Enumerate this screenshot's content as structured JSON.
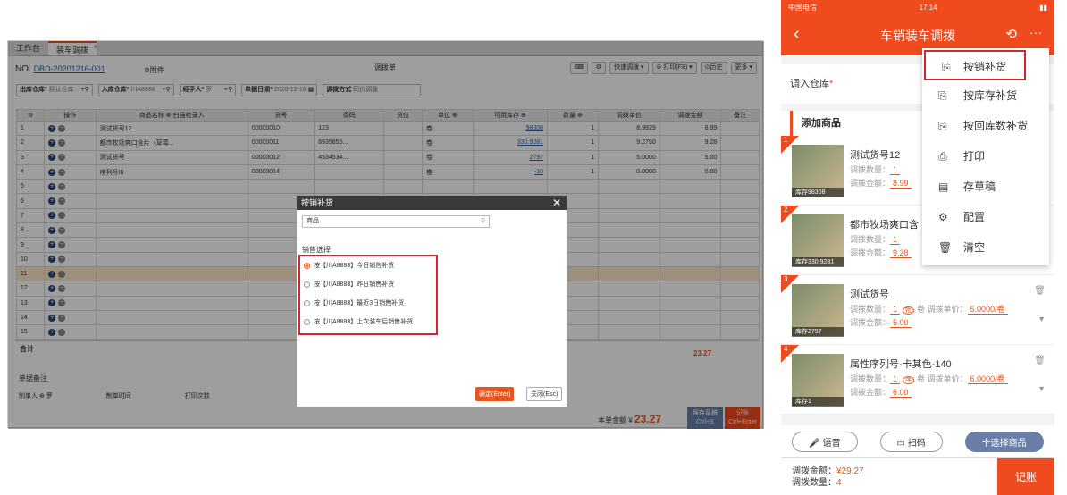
{
  "desktop": {
    "tabs": [
      "工作台",
      "装车调拨"
    ],
    "no_label": "NO.",
    "no_value": "DBD-20201216-001",
    "attach": "⊘附件",
    "title": "调拨单",
    "buttons": [
      "快速调拨 ▾",
      "⊜ 打印(F8) ▾",
      "⊙历史",
      "更多 ▾"
    ],
    "fields": {
      "out_wh": "出库仓库*",
      "out_wh_v": "默认仓库",
      "in_wh": "入库仓库*",
      "in_wh_v": "川A8888",
      "handler": "经手人*",
      "handler_v": "罗",
      "date": "单据日期*",
      "date_v": "2020-12-16",
      "method": "调拨方式",
      "method_v": "同价调拨"
    },
    "columns": [
      "⚙",
      "操作",
      "商品名称 ⊕ 扫描枪录入",
      "货号",
      "条码",
      "货位",
      "单位 ⊕",
      "可用库存 ⊕",
      "数量 ⊕",
      "调拨单价",
      "调拨金额",
      "备注"
    ],
    "rows": [
      {
        "n": "1",
        "name": "测试货号12",
        "code": "00000010",
        "bar": "123",
        "unit": "卷",
        "stock": "98308",
        "qty": "1",
        "price": "8.9929",
        "amt": "8.99"
      },
      {
        "n": "2",
        "name": "都市牧场爽口含片（草莓...",
        "code": "00000011",
        "bar": "6935855...",
        "unit": "卷",
        "stock": "330.9281",
        "qty": "1",
        "price": "9.2790",
        "amt": "9.28"
      },
      {
        "n": "3",
        "name": "测试货号",
        "code": "00000012",
        "bar": "4534534...",
        "unit": "卷",
        "stock": "2797",
        "qty": "1",
        "price": "5.0000",
        "amt": "5.00"
      },
      {
        "n": "4",
        "name": "序列号III",
        "code": "00000014",
        "bar": "",
        "unit": "卷",
        "stock": "-10",
        "qty": "1",
        "price": "0.0000",
        "amt": "0.00"
      },
      {
        "n": "5"
      },
      {
        "n": "6"
      },
      {
        "n": "7"
      },
      {
        "n": "8"
      },
      {
        "n": "9"
      },
      {
        "n": "10"
      },
      {
        "n": "11"
      },
      {
        "n": "12"
      },
      {
        "n": "13"
      },
      {
        "n": "14"
      },
      {
        "n": "15"
      }
    ],
    "total_label": "合计",
    "total_amt": "23.27",
    "note_label": "单据备注",
    "bottom": [
      "制单人 ⊕ 罗",
      "制单时间",
      "打印次数"
    ],
    "sum_label": "本单金额 ¥",
    "sum_value": "23.27",
    "save_draft": "保存草稿 Ctrl+S",
    "save_acc": "记账 Ctrl+Enter",
    "dialog": {
      "title": "按销补货",
      "search": "商品",
      "section": "销售选择",
      "options": [
        "按【川A8888】今日销售补货",
        "按【川A8888】昨日销售补货",
        "按【川A8888】最近3日销售补货",
        "按【川A8888】上次装车后销售补货"
      ],
      "ok": "确定(Enter)",
      "cancel": "关闭(Esc)"
    }
  },
  "phone": {
    "status_left": "中国电信",
    "status_time": "17:14",
    "title": "车销装车调拨",
    "in_wh": "调入仓库",
    "add": "添加商品",
    "items": [
      {
        "n": "1",
        "name": "测试货号12",
        "qty": "1",
        "amt": "8.99",
        "stock": "库存98308"
      },
      {
        "n": "2",
        "name": "都市牧场爽口含",
        "qty": "1",
        "amt": "9.28",
        "stock": "库存330.9281"
      },
      {
        "n": "3",
        "name": "测试货号",
        "qty": "1",
        "amt": "5.00",
        "stock": "库存2797",
        "tag": "批",
        "unit_price": "5.0000/卷"
      },
      {
        "n": "4",
        "name": "属性序列号-卡其色-140",
        "qty": "1",
        "amt": "6.00",
        "stock": "库存1",
        "tag": "序",
        "unit_price": "6.0000/卷"
      }
    ],
    "qty_label": "调拨数量：",
    "amt_label": "调拨金额：",
    "unit_label": "卷 调拨单价：",
    "menu": [
      "按销补货",
      "按库存补货",
      "按回库数补货",
      "打印",
      "存草稿",
      "配置",
      "清空"
    ],
    "btns": [
      "语音",
      "扫码",
      "十选择商品"
    ],
    "foot_amt_label": "调拨金额：",
    "foot_amt": "¥29.27",
    "foot_qty_label": "调拨数量：",
    "foot_qty": "4",
    "account": "记账"
  }
}
